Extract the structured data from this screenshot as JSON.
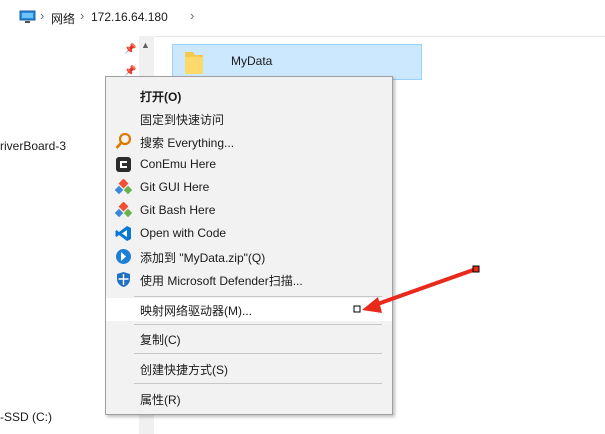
{
  "address_bar": {
    "crumbs": [
      "网络",
      "172.16.64.180"
    ],
    "separator": "›"
  },
  "nav_pane": {
    "items": [
      "riverBoard-3",
      "-SSD (C:)"
    ]
  },
  "content": {
    "folder_name": "MyData"
  },
  "context_menu": {
    "items": [
      {
        "label": "打开(O)",
        "icon": "none",
        "bold": true
      },
      {
        "label": "固定到快速访问",
        "icon": "none"
      },
      {
        "label": "搜索 Everything...",
        "icon": "magnifier-icon"
      },
      {
        "label": "ConEmu Here",
        "icon": "conemu-icon"
      },
      {
        "label": "Git GUI Here",
        "icon": "git-gui-icon"
      },
      {
        "label": "Git Bash Here",
        "icon": "git-bash-icon"
      },
      {
        "label": "Open with Code",
        "icon": "vscode-icon"
      },
      {
        "label": "添加到 \"MyData.zip\"(Q)",
        "icon": "bandizip-icon"
      },
      {
        "label": "使用 Microsoft Defender扫描...",
        "icon": "defender-shield-icon"
      },
      {
        "label": "映射网络驱动器(M)...",
        "icon": "none",
        "highlighted": true
      },
      {
        "label": "复制(C)",
        "icon": "none"
      },
      {
        "label": "创建快捷方式(S)",
        "icon": "none"
      },
      {
        "label": "属性(R)",
        "icon": "none"
      }
    ]
  },
  "colors": {
    "selection_bg": "#cce8ff",
    "menu_bg": "#f2f2f2",
    "annotation_arrow": "#e8291c"
  }
}
